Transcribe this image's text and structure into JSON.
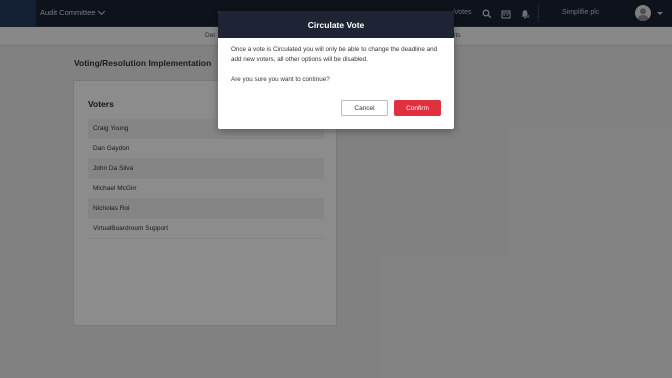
{
  "topbar": {
    "committee": "Audit Committee",
    "nav_votes": "Votes",
    "organization": "Simplifie plc",
    "icons": [
      "search-icon",
      "calendar-icon",
      "bell-icon",
      "avatar-icon"
    ],
    "brand_color": "#233a5c"
  },
  "subnav": {
    "tabs": [
      "Det",
      "lts"
    ]
  },
  "page": {
    "title": "Voting/Resolution Implementation"
  },
  "voters": {
    "title": "Voters",
    "items": [
      "Craig Young",
      "Dan Gaydon",
      "John Da Silva",
      "Michael McGirr",
      "Nicholas Roi",
      "VirtualBoardroom Support"
    ]
  },
  "modal": {
    "title": "Circulate Vote",
    "message": "Once a vote is Circulated you will only be able to change the deadline and add new voters, all other options will be disabled.",
    "question": "Are you sure you want to continue?",
    "cancel_label": "Cancel",
    "confirm_label": "Confirm",
    "confirm_color": "#e0313f"
  }
}
